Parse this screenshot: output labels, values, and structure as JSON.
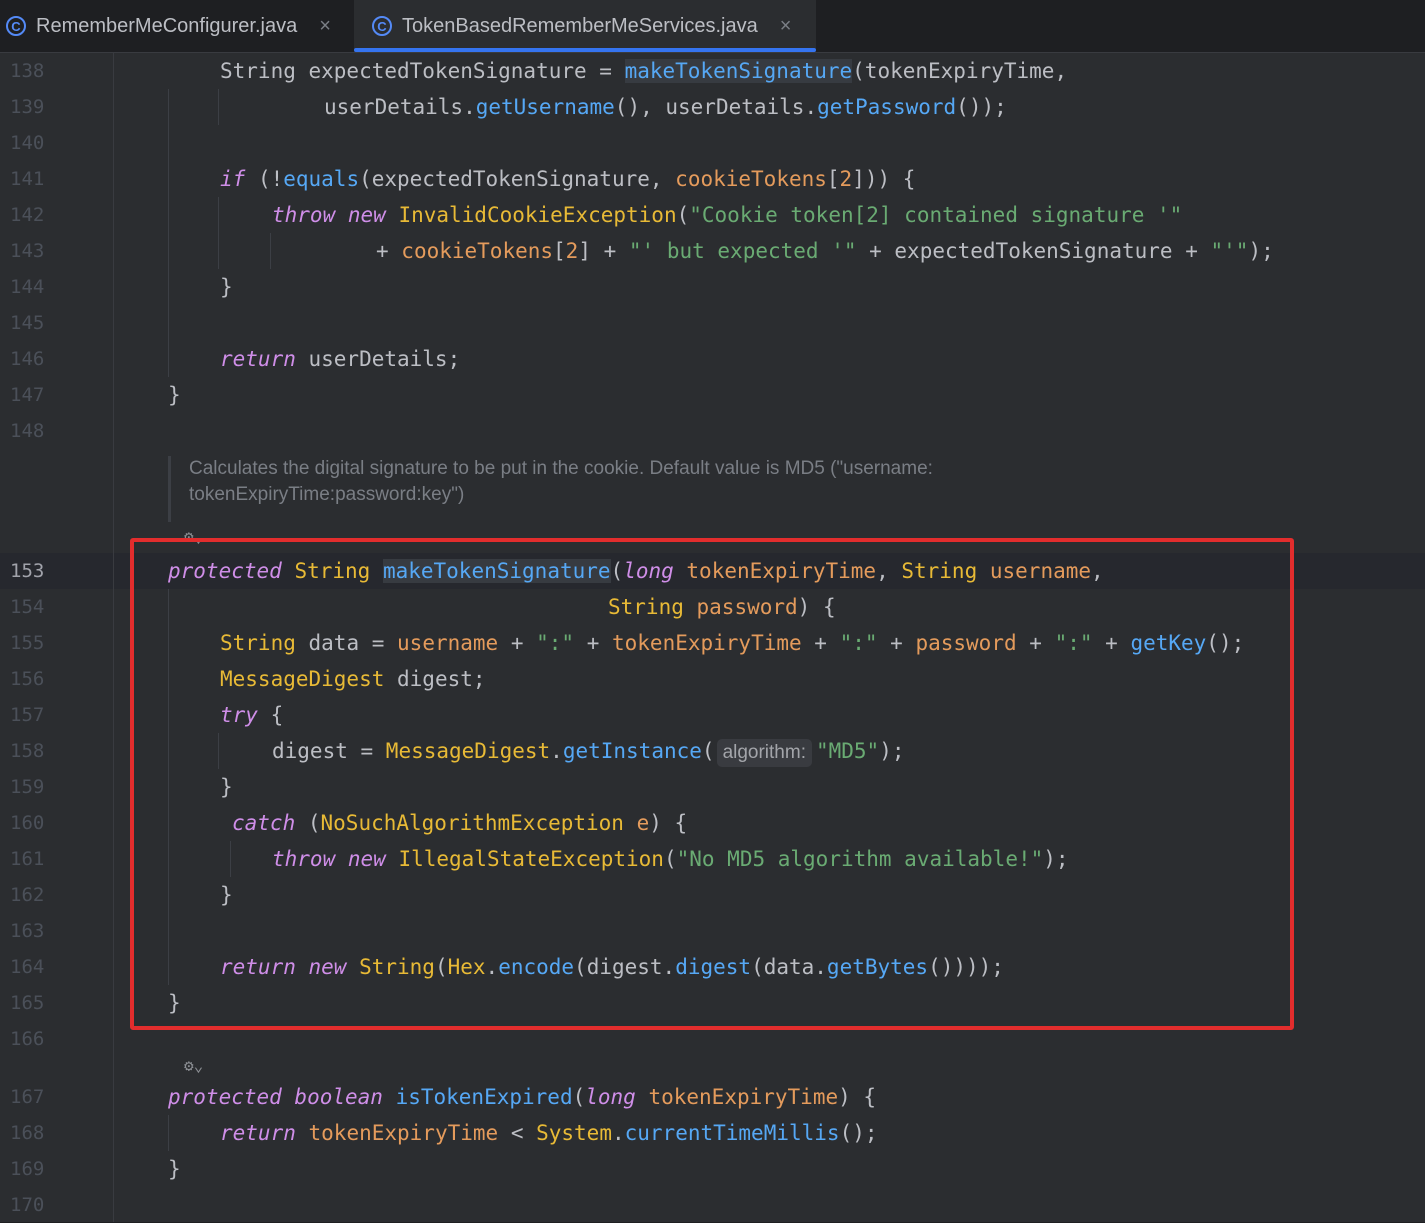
{
  "tabs": [
    {
      "label": "RememberMeConfigurer.java",
      "icon": "C",
      "active": false
    },
    {
      "label": "TokenBasedRememberMeServices.java",
      "icon": "C",
      "active": true
    }
  ],
  "close_glyph": "×",
  "doc_comment": {
    "line1": "Calculates the digital signature to be put in the cookie. Default value is MD5 (\"username:",
    "line2": "tokenExpiryTime:password:key\")"
  },
  "inlay_hint": "algorithm:",
  "line_numbers": [
    "138",
    "139",
    "140",
    "141",
    "142",
    "143",
    "144",
    "145",
    "146",
    "147",
    "148",
    "153",
    "154",
    "155",
    "156",
    "157",
    "158",
    "159",
    "160",
    "161",
    "162",
    "163",
    "164",
    "165",
    "166",
    "167",
    "168",
    "169",
    "170"
  ],
  "current_line": "153",
  "code": {
    "l138": [
      [
        "tx",
        "String expectedTokenSignature = "
      ],
      [
        "mc hl",
        "makeTokenSignature"
      ],
      [
        "tx",
        "(tokenExpiryTime,"
      ]
    ],
    "l139": [
      [
        "tx",
        "userDetails."
      ],
      [
        "mc",
        "getUsername"
      ],
      [
        "tx",
        "(), userDetails."
      ],
      [
        "mc",
        "getPassword"
      ],
      [
        "tx",
        "());"
      ]
    ],
    "l141": [
      [
        "kw",
        "if"
      ],
      [
        "tx",
        " (!"
      ],
      [
        "mc",
        "equals"
      ],
      [
        "tx",
        "(expectedTokenSignature, "
      ],
      [
        "pm",
        "cookieTokens"
      ],
      [
        "tx",
        "["
      ],
      [
        "nm",
        "2"
      ],
      [
        "tx",
        "])) {"
      ]
    ],
    "l142": [
      [
        "kw",
        "throw new "
      ],
      [
        "ty",
        "InvalidCookieException"
      ],
      [
        "tx",
        "("
      ],
      [
        "st",
        "\"Cookie token[2] contained signature '\""
      ]
    ],
    "l143": [
      [
        "tx",
        "+ "
      ],
      [
        "pm",
        "cookieTokens"
      ],
      [
        "tx",
        "["
      ],
      [
        "nm",
        "2"
      ],
      [
        "tx",
        "] + "
      ],
      [
        "st",
        "\"' but expected '\""
      ],
      [
        "tx",
        " + expectedTokenSignature + "
      ],
      [
        "st",
        "\"'\""
      ],
      [
        "tx",
        ");"
      ]
    ],
    "l144": [
      [
        "tx",
        "}"
      ]
    ],
    "l146": [
      [
        "kw",
        "return"
      ],
      [
        "tx",
        " userDetails;"
      ]
    ],
    "l147": [
      [
        "tx",
        "}"
      ]
    ],
    "l153": [
      [
        "kw",
        "protected "
      ],
      [
        "ty",
        "String "
      ],
      [
        "mc hl",
        "makeTokenSignature"
      ],
      [
        "tx",
        "("
      ],
      [
        "kw",
        "long "
      ],
      [
        "pm",
        "tokenExpiryTime"
      ],
      [
        "tx",
        ", "
      ],
      [
        "ty",
        "String "
      ],
      [
        "pm",
        "username"
      ],
      [
        "tx",
        ","
      ]
    ],
    "l154": [
      [
        "ty",
        "String "
      ],
      [
        "pm",
        "password"
      ],
      [
        "tx",
        ") {"
      ]
    ],
    "l155": [
      [
        "ty",
        "String "
      ],
      [
        "tx",
        "data = "
      ],
      [
        "pm",
        "username"
      ],
      [
        "tx",
        " + "
      ],
      [
        "st",
        "\":\""
      ],
      [
        "tx",
        " + "
      ],
      [
        "pm",
        "tokenExpiryTime"
      ],
      [
        "tx",
        " + "
      ],
      [
        "st",
        "\":\""
      ],
      [
        "tx",
        " + "
      ],
      [
        "pm",
        "password"
      ],
      [
        "tx",
        " + "
      ],
      [
        "st",
        "\":\""
      ],
      [
        "tx",
        " + "
      ],
      [
        "mc",
        "getKey"
      ],
      [
        "tx",
        "();"
      ]
    ],
    "l156": [
      [
        "ty",
        "MessageDigest "
      ],
      [
        "tx",
        "digest;"
      ]
    ],
    "l157": [
      [
        "kw",
        "try"
      ],
      [
        "tx",
        " {"
      ]
    ],
    "l158a": [
      [
        "tx",
        "digest = "
      ],
      [
        "ty",
        "MessageDigest"
      ],
      [
        "tx",
        "."
      ],
      [
        "mc",
        "getInstance"
      ],
      [
        "tx",
        "("
      ]
    ],
    "l158b": [
      [
        "st",
        "\"MD5\""
      ],
      [
        "tx",
        ");"
      ]
    ],
    "l159": [
      [
        "tx",
        "}"
      ]
    ],
    "l160": [
      [
        "kw",
        "catch"
      ],
      [
        "tx",
        " ("
      ],
      [
        "ty",
        "NoSuchAlgorithmException "
      ],
      [
        "pm",
        "e"
      ],
      [
        "tx",
        ") {"
      ]
    ],
    "l161": [
      [
        "kw",
        "throw new "
      ],
      [
        "ty",
        "IllegalStateException"
      ],
      [
        "tx",
        "("
      ],
      [
        "st",
        "\"No MD5 algorithm available!\""
      ],
      [
        "tx",
        ");"
      ]
    ],
    "l162": [
      [
        "tx",
        "}"
      ]
    ],
    "l164": [
      [
        "kw",
        "return new "
      ],
      [
        "ty",
        "String"
      ],
      [
        "tx",
        "("
      ],
      [
        "ty",
        "Hex"
      ],
      [
        "tx",
        "."
      ],
      [
        "mc",
        "encode"
      ],
      [
        "tx",
        "(digest."
      ],
      [
        "mc",
        "digest"
      ],
      [
        "tx",
        "(data."
      ],
      [
        "mc",
        "getBytes"
      ],
      [
        "tx",
        "())));"
      ]
    ],
    "l165": [
      [
        "tx",
        "}"
      ]
    ],
    "l167": [
      [
        "kw",
        "protected boolean "
      ],
      [
        "mc",
        "isTokenExpired"
      ],
      [
        "tx",
        "("
      ],
      [
        "kw",
        "long "
      ],
      [
        "pm",
        "tokenExpiryTime"
      ],
      [
        "tx",
        ") {"
      ]
    ],
    "l168": [
      [
        "kw",
        "return "
      ],
      [
        "pm",
        "tokenExpiryTime"
      ],
      [
        "tx",
        " < "
      ],
      [
        "ty",
        "System"
      ],
      [
        "tx",
        "."
      ],
      [
        "mc",
        "currentTimeMillis"
      ],
      [
        "tx",
        "();"
      ]
    ],
    "l169": [
      [
        "tx",
        "}"
      ]
    ]
  },
  "colors": {
    "highlight_box": "#e22d2d",
    "accent": "#3574f0"
  }
}
